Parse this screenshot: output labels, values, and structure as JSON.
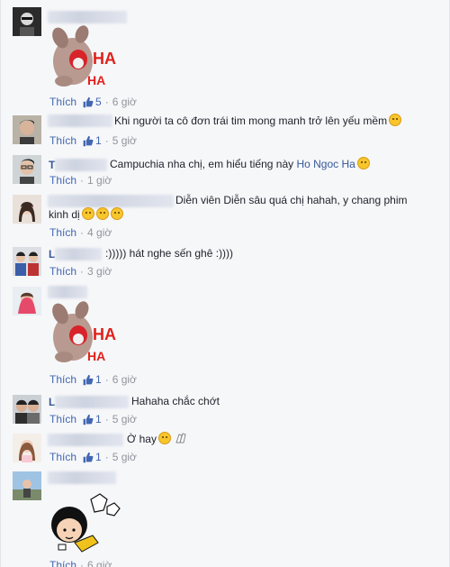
{
  "comments": [
    {
      "name_prefix": "",
      "text": "",
      "tag": "",
      "like": "Thích",
      "likes": "5",
      "time": "6 giờ",
      "sticker_text": [
        "HA",
        "HA"
      ]
    },
    {
      "name_prefix": "",
      "text": "Khi người ta cô đơn trái tim mong manh trở lên yếu mềm",
      "tag": "",
      "like": "Thích",
      "likes": "1",
      "time": "5 giờ"
    },
    {
      "name_prefix": "T",
      "text": "Campuchia nha chị, em hiểu tiếng này",
      "tag": "Ho Ngoc Ha",
      "like": "Thích",
      "likes": "",
      "time": "1 giờ"
    },
    {
      "name_prefix": "",
      "text": "Diễn viên Diễn sâu quá chị hahah, y chang phim",
      "text2": "kinh dị",
      "tag": "",
      "like": "Thích",
      "likes": "",
      "time": "4 giờ"
    },
    {
      "name_prefix": "L",
      "text": ":))))) hát nghe sến ghê :))))",
      "tag": "",
      "like": "Thích",
      "likes": "",
      "time": "3 giờ"
    },
    {
      "name_prefix": "",
      "text": "",
      "tag": "",
      "like": "Thích",
      "likes": "1",
      "time": "6 giờ",
      "sticker_text": [
        "HA",
        "HA"
      ]
    },
    {
      "name_prefix": "L",
      "text": "Hahaha chắc chớt",
      "tag": "",
      "like": "Thích",
      "likes": "1",
      "time": "5 giờ"
    },
    {
      "name_prefix": "",
      "text": "Ờ hay",
      "tag": "",
      "like": "Thích",
      "likes": "1",
      "time": "5 giờ"
    },
    {
      "name_prefix": "",
      "text": "",
      "tag": "",
      "like": "Thích",
      "likes": "",
      "time": "6 giờ"
    }
  ],
  "colors": {
    "link": "#365899",
    "meta": "#90949c",
    "like_blue": "#4267b2",
    "sticker_red": "#e0201b"
  },
  "icons": {
    "like": "thumbs-up-icon",
    "emoji": "smiley-emoji-icon"
  }
}
